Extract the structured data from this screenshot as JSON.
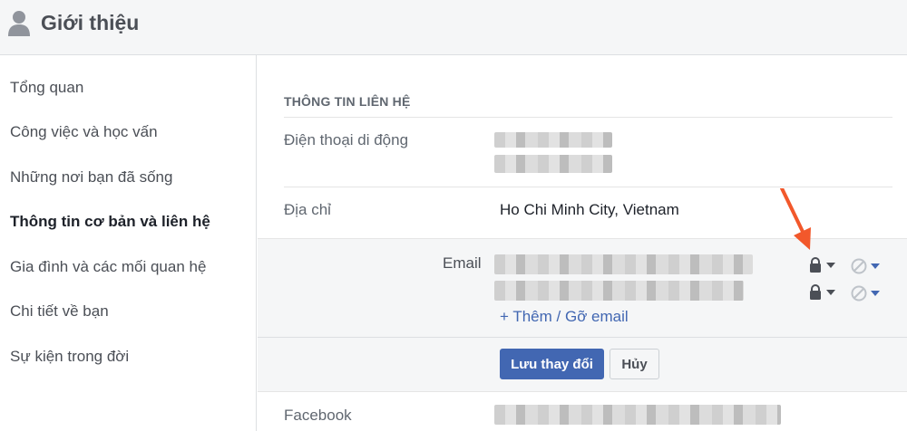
{
  "header": {
    "title": "Giới thiệu",
    "icon": "person-icon"
  },
  "sidebar": {
    "items": [
      {
        "label": "Tổng quan"
      },
      {
        "label": "Công việc và học vấn"
      },
      {
        "label": "Những nơi bạn đã sống"
      },
      {
        "label": "Thông tin cơ bản và liên hệ",
        "active": true
      },
      {
        "label": "Gia đình và các mối quan hệ"
      },
      {
        "label": "Chi tiết về bạn"
      },
      {
        "label": "Sự kiện trong đời"
      }
    ]
  },
  "contact": {
    "section_title": "THÔNG TIN LIÊN HỆ",
    "phone_label": "Điện thoại di động",
    "address_label": "Địa chỉ",
    "address_value": "Ho Chi Minh City, Vietnam",
    "email_label": "Email",
    "add_remove_email": "+ Thêm / Gỡ email",
    "save_button": "Lưu thay đổi",
    "cancel_button": "Hủy",
    "facebook_label": "Facebook"
  },
  "colors": {
    "accent": "#4267b2",
    "annotation_arrow": "#f2582b",
    "panel_bg": "#f5f6f7"
  }
}
